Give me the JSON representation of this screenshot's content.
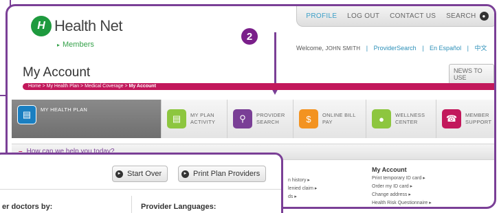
{
  "brand": {
    "logo_mark": "H",
    "name": "Health Net"
  },
  "members_link": "Members",
  "topnav": {
    "profile": "PROFILE",
    "logout": "LOG OUT",
    "contact": "CONTACT US",
    "search": "SEARCH"
  },
  "welcome": {
    "prefix": "Welcome,",
    "user": "JOHN SMITH",
    "provider_search": "ProviderSearch",
    "espanol": "En Español",
    "chinese": "中文"
  },
  "step_number": "2",
  "page_title": "My Account",
  "news_button": "NEWS TO USE",
  "breadcrumb": {
    "path": "Home > My Health Plan > Medical Coverage > ",
    "current": "My Account"
  },
  "tabs": [
    {
      "label": "MY HEALTH PLAN",
      "color": "#1a7fc1"
    },
    {
      "label": "MY PLAN ACTIVITY",
      "color": "#8dc63f"
    },
    {
      "label": "PROVIDER SEARCH",
      "color": "#7a3f96"
    },
    {
      "label": "ONLINE BILL PAY",
      "color": "#f39321"
    },
    {
      "label": "WELLNESS CENTER",
      "color": "#8dc63f"
    },
    {
      "label": "MEMBER SUPPORT",
      "color": "#c2185b"
    }
  ],
  "help_bar": "How can we help you today?",
  "snippet_links": [
    "n history ▸",
    "lenied claim ▸",
    "ds ▸"
  ],
  "my_account_section": {
    "heading": "My Account",
    "links": [
      "Print temporary ID card ▸",
      "Order my ID card ▸",
      "Change address ▸",
      "Health Risk Questionnaire ▸"
    ]
  },
  "overlay": {
    "start_over": "Start Over",
    "print_plan_providers": "Print Plan Providers",
    "filter_label_left": "er doctors by:",
    "filter_label_right": "Provider Languages:"
  },
  "colors": {
    "brand_green": "#1e9a3e",
    "accent_purple": "#7a3f96",
    "breadcrumb_magenta": "#c2185b",
    "link_blue": "#2b8fb8"
  }
}
